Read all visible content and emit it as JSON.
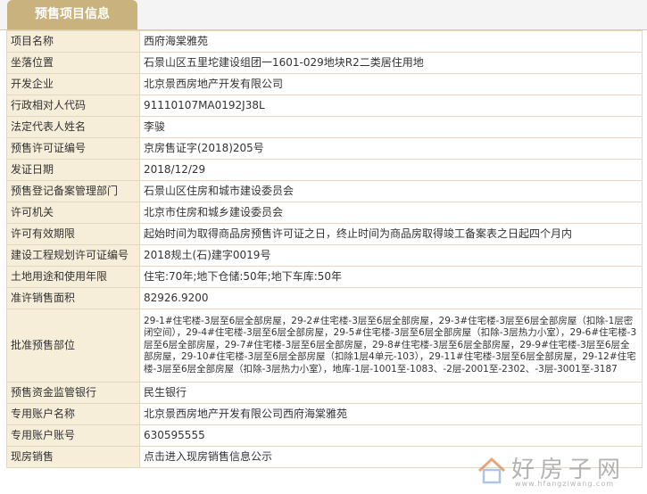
{
  "tab": {
    "title": "预售项目信息"
  },
  "rows": [
    {
      "label": "项目名称",
      "value": "西府海棠雅苑"
    },
    {
      "label": "坐落位置",
      "value": "石景山区五里坨建设组团一1601-029地块R2二类居住用地"
    },
    {
      "label": "开发企业",
      "value": "北京景西房地产开发有限公司"
    },
    {
      "label": "行政相对人代码",
      "value": "91110107MA0192J38L"
    },
    {
      "label": "法定代表人姓名",
      "value": "李骏"
    },
    {
      "label": "预售许可证编号",
      "value": "京房售证字(2018)205号"
    },
    {
      "label": "发证日期",
      "value": "2018/12/29"
    },
    {
      "label": "预售登记备案管理部门",
      "value": "石景山区住房和城市建设委员会"
    },
    {
      "label": "许可机关",
      "value": "北京市住房和城乡建设委员会"
    },
    {
      "label": "许可有效期限",
      "value": "起始时间为取得商品房预售许可证之日，终止时间为商品房取得竣工备案表之日起四个月内"
    },
    {
      "label": "建设工程规划许可证编号",
      "value": "2018规土(石)建字0019号"
    },
    {
      "label": "土地用途和使用年限",
      "value": "住宅:70年;地下仓储:50年;地下车库:50年"
    },
    {
      "label": "准许销售面积",
      "value": "82926.9200"
    },
    {
      "label": "批准预售部位",
      "value": "29-1#住宅楼-3层至6层全部房屋，29-2#住宅楼-3层至6层全部房屋，29-3#住宅楼-3层至6层全部房屋（扣除-1层密闭空间），29-4#住宅楼-3层至6层全部房屋，29-5#住宅楼-3层至6层全部房屋（扣除-3层热力小室），29-6#住宅楼-3层至6层全部房屋，29-7#住宅楼-3层至6层全部房屋，29-8#住宅楼-3层至6层全部房屋，29-9#住宅楼-3层至6层全部房屋，29-10#住宅楼-3层至6层全部房屋（扣除1层4单元-103），29-11#住宅楼-3层至6层全部房屋，29-12#住宅楼-3层至6层全部房屋（扣除-3层热力小室），地库-1层-1001至-1083、-2层-2001至-2302、-3层-3001至-3187"
    },
    {
      "label": "预售资金监管银行",
      "value": "民生银行"
    },
    {
      "label": "专用账户名称",
      "value": "北京景西房地产开发有限公司西府海棠雅苑"
    },
    {
      "label": "专用账户账号",
      "value": "630595555"
    },
    {
      "label": "现房销售",
      "value": "点击进入现房销售信息公示"
    }
  ],
  "watermark": {
    "text": "好房子网",
    "url": "www.hfangziwang.com"
  }
}
